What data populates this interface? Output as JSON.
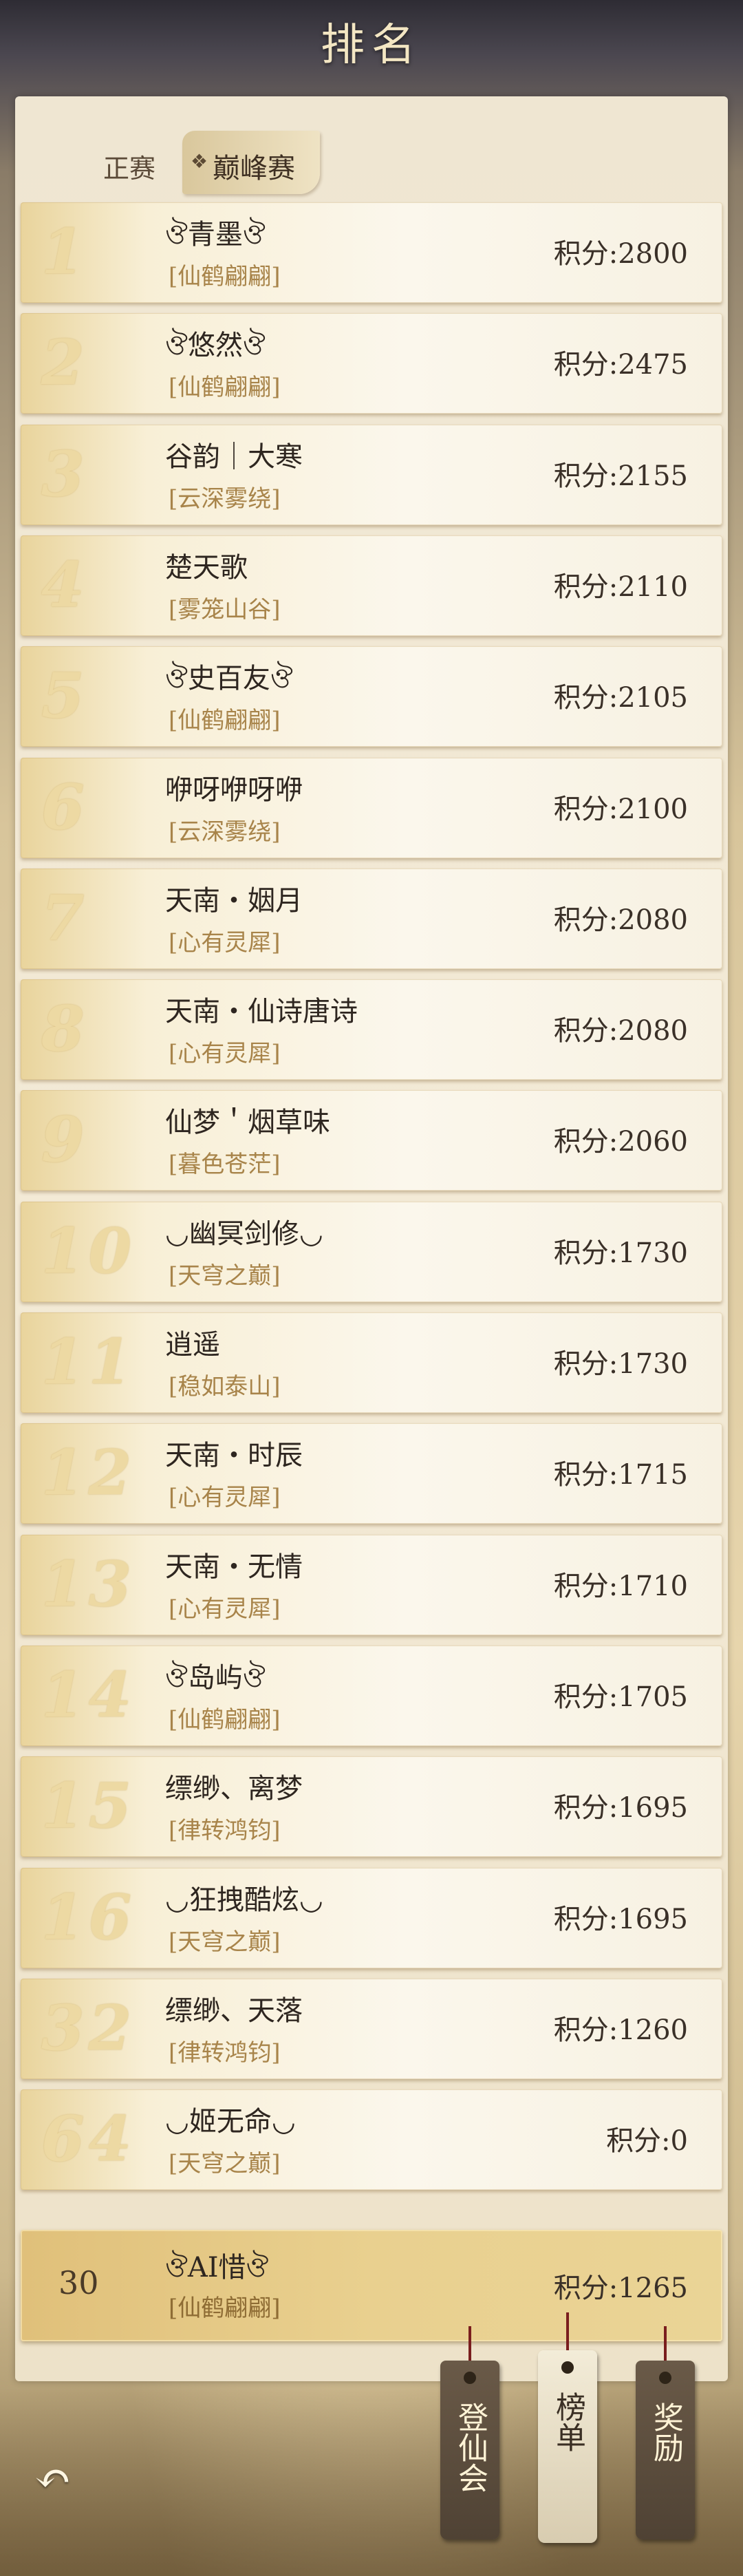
{
  "header": {
    "title": "排名"
  },
  "tabs": {
    "normal": "正赛",
    "active": "巅峰赛"
  },
  "score_label": "积分:",
  "rows": [
    {
      "rank": "1",
      "name": "ঔ青墨ঔ",
      "guild": "[仙鹤翩翩]",
      "score": "积分:2800"
    },
    {
      "rank": "2",
      "name": "ঔ悠然ঔ",
      "guild": "[仙鹤翩翩]",
      "score": "积分:2475"
    },
    {
      "rank": "3",
      "name": "谷韵｜大寒",
      "guild": "[云深雾绕]",
      "score": "积分:2155"
    },
    {
      "rank": "4",
      "name": "楚天歌",
      "guild": "[雾笼山谷]",
      "score": "积分:2110"
    },
    {
      "rank": "5",
      "name": "ঔ史百友ঔ",
      "guild": "[仙鹤翩翩]",
      "score": "积分:2105"
    },
    {
      "rank": "6",
      "name": "咿呀咿呀咿",
      "guild": "[云深雾绕]",
      "score": "积分:2100"
    },
    {
      "rank": "7",
      "name": "天南・姻月",
      "guild": "[心有灵犀]",
      "score": "积分:2080"
    },
    {
      "rank": "8",
      "name": "天南・仙诗唐诗",
      "guild": "[心有灵犀]",
      "score": "积分:2080"
    },
    {
      "rank": "9",
      "name": "仙梦＇烟草味",
      "guild": "[暮色苍茫]",
      "score": "积分:2060"
    },
    {
      "rank": "10",
      "name": "◡幽冥剑修◡",
      "guild": "[天穹之巅]",
      "score": "积分:1730"
    },
    {
      "rank": "11",
      "name": "逍遥",
      "guild": "[稳如泰山]",
      "score": "积分:1730"
    },
    {
      "rank": "12",
      "name": "天南・时辰",
      "guild": "[心有灵犀]",
      "score": "积分:1715"
    },
    {
      "rank": "13",
      "name": "天南・无情",
      "guild": "[心有灵犀]",
      "score": "积分:1710"
    },
    {
      "rank": "14",
      "name": "ঔ岛屿ঔ",
      "guild": "[仙鹤翩翩]",
      "score": "积分:1705"
    },
    {
      "rank": "15",
      "name": "缥缈、离梦",
      "guild": "[律转鸿钧]",
      "score": "积分:1695"
    },
    {
      "rank": "16",
      "name": "◡狂拽酷炫◡",
      "guild": "[天穹之巅]",
      "score": "积分:1695"
    },
    {
      "rank": "32",
      "name": "缥缈、天落",
      "guild": "[律转鸿钧]",
      "score": "积分:1260"
    },
    {
      "rank": "64",
      "name": "◡姬无命◡",
      "guild": "[天穹之巅]",
      "score": "积分:0"
    }
  ],
  "me": {
    "rank": "30",
    "name": "ঔAI惜ঔ",
    "guild": "[仙鹤翩翩]",
    "score": "积分:1265"
  },
  "bottom": {
    "back_icon": "back-arrow-icon",
    "tag1": "登仙会",
    "tag2": "榜单",
    "tag3": "奖励"
  }
}
